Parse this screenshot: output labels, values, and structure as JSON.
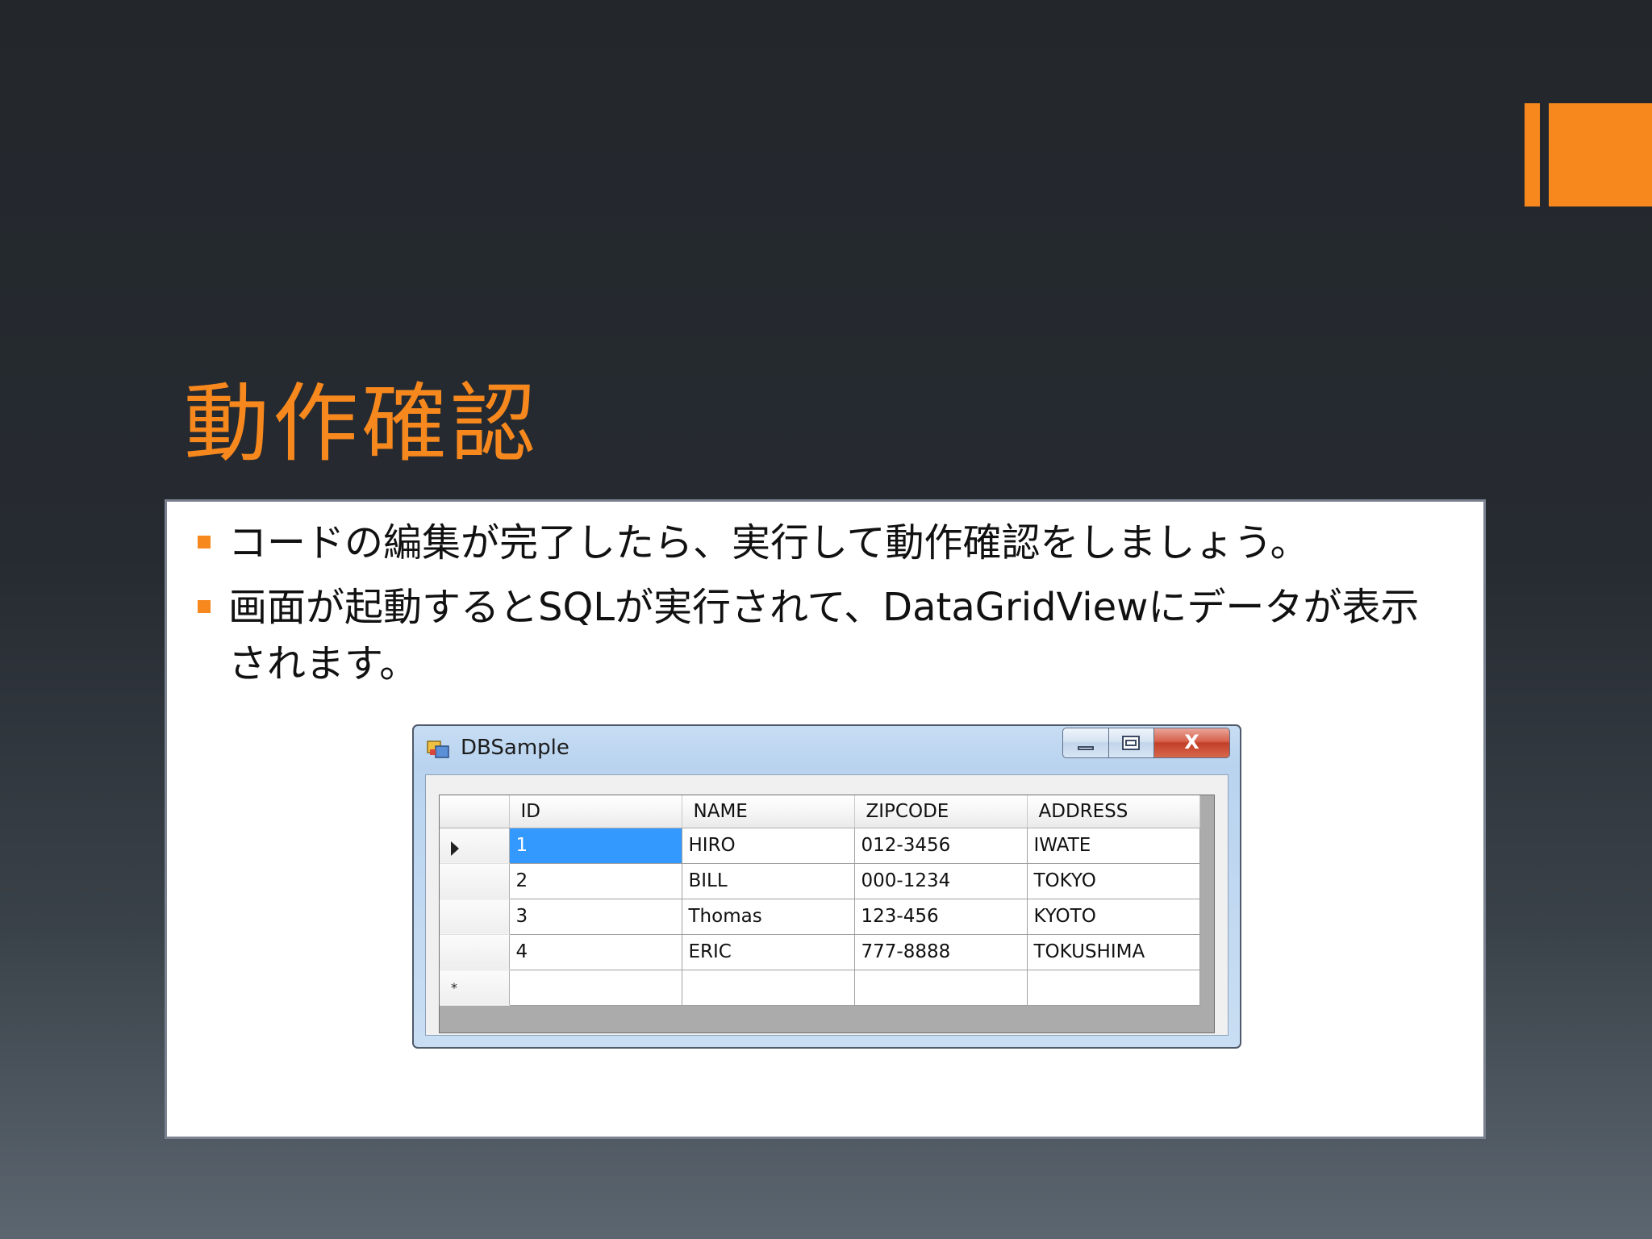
{
  "slide": {
    "title": "動作確認",
    "bullets": [
      "コードの編集が完了したら、実行して動作確認をしましょう。",
      "画面が起動するとSQLが実行されて、DataGridViewにデータが表示されます。"
    ]
  },
  "window": {
    "title": "DBSample",
    "buttons": {
      "minimize": "",
      "maximize": "",
      "close": "X"
    },
    "grid": {
      "columns": [
        "ID",
        "NAME",
        "ZIPCODE",
        "ADDRESS"
      ],
      "rows": [
        [
          "1",
          "HIRO",
          "012-3456",
          "IWATE"
        ],
        [
          "2",
          "BILL",
          "000-1234",
          "TOKYO"
        ],
        [
          "3",
          "Thomas",
          "123-456",
          "KYOTO"
        ],
        [
          "4",
          "ERIC",
          "777-8888",
          "TOKUSHIMA"
        ]
      ],
      "new_row_marker": "*"
    }
  },
  "colors": {
    "accent": "#f7881e",
    "selection": "#3399ff"
  }
}
